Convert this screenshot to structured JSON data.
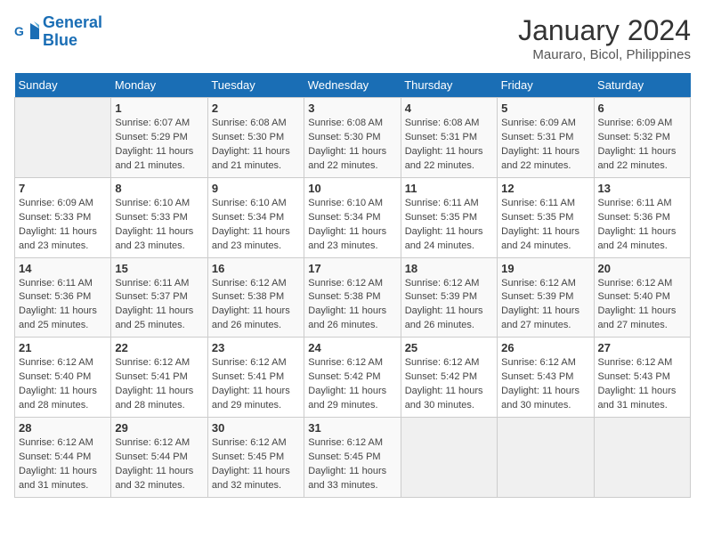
{
  "logo": {
    "line1": "General",
    "line2": "Blue"
  },
  "title": "January 2024",
  "subtitle": "Mauraro, Bicol, Philippines",
  "days_of_week": [
    "Sunday",
    "Monday",
    "Tuesday",
    "Wednesday",
    "Thursday",
    "Friday",
    "Saturday"
  ],
  "weeks": [
    [
      {
        "num": "",
        "info": ""
      },
      {
        "num": "1",
        "info": "Sunrise: 6:07 AM\nSunset: 5:29 PM\nDaylight: 11 hours and 21 minutes."
      },
      {
        "num": "2",
        "info": "Sunrise: 6:08 AM\nSunset: 5:30 PM\nDaylight: 11 hours and 21 minutes."
      },
      {
        "num": "3",
        "info": "Sunrise: 6:08 AM\nSunset: 5:30 PM\nDaylight: 11 hours and 22 minutes."
      },
      {
        "num": "4",
        "info": "Sunrise: 6:08 AM\nSunset: 5:31 PM\nDaylight: 11 hours and 22 minutes."
      },
      {
        "num": "5",
        "info": "Sunrise: 6:09 AM\nSunset: 5:31 PM\nDaylight: 11 hours and 22 minutes."
      },
      {
        "num": "6",
        "info": "Sunrise: 6:09 AM\nSunset: 5:32 PM\nDaylight: 11 hours and 22 minutes."
      }
    ],
    [
      {
        "num": "7",
        "info": "Sunrise: 6:09 AM\nSunset: 5:33 PM\nDaylight: 11 hours and 23 minutes."
      },
      {
        "num": "8",
        "info": "Sunrise: 6:10 AM\nSunset: 5:33 PM\nDaylight: 11 hours and 23 minutes."
      },
      {
        "num": "9",
        "info": "Sunrise: 6:10 AM\nSunset: 5:34 PM\nDaylight: 11 hours and 23 minutes."
      },
      {
        "num": "10",
        "info": "Sunrise: 6:10 AM\nSunset: 5:34 PM\nDaylight: 11 hours and 23 minutes."
      },
      {
        "num": "11",
        "info": "Sunrise: 6:11 AM\nSunset: 5:35 PM\nDaylight: 11 hours and 24 minutes."
      },
      {
        "num": "12",
        "info": "Sunrise: 6:11 AM\nSunset: 5:35 PM\nDaylight: 11 hours and 24 minutes."
      },
      {
        "num": "13",
        "info": "Sunrise: 6:11 AM\nSunset: 5:36 PM\nDaylight: 11 hours and 24 minutes."
      }
    ],
    [
      {
        "num": "14",
        "info": "Sunrise: 6:11 AM\nSunset: 5:36 PM\nDaylight: 11 hours and 25 minutes."
      },
      {
        "num": "15",
        "info": "Sunrise: 6:11 AM\nSunset: 5:37 PM\nDaylight: 11 hours and 25 minutes."
      },
      {
        "num": "16",
        "info": "Sunrise: 6:12 AM\nSunset: 5:38 PM\nDaylight: 11 hours and 26 minutes."
      },
      {
        "num": "17",
        "info": "Sunrise: 6:12 AM\nSunset: 5:38 PM\nDaylight: 11 hours and 26 minutes."
      },
      {
        "num": "18",
        "info": "Sunrise: 6:12 AM\nSunset: 5:39 PM\nDaylight: 11 hours and 26 minutes."
      },
      {
        "num": "19",
        "info": "Sunrise: 6:12 AM\nSunset: 5:39 PM\nDaylight: 11 hours and 27 minutes."
      },
      {
        "num": "20",
        "info": "Sunrise: 6:12 AM\nSunset: 5:40 PM\nDaylight: 11 hours and 27 minutes."
      }
    ],
    [
      {
        "num": "21",
        "info": "Sunrise: 6:12 AM\nSunset: 5:40 PM\nDaylight: 11 hours and 28 minutes."
      },
      {
        "num": "22",
        "info": "Sunrise: 6:12 AM\nSunset: 5:41 PM\nDaylight: 11 hours and 28 minutes."
      },
      {
        "num": "23",
        "info": "Sunrise: 6:12 AM\nSunset: 5:41 PM\nDaylight: 11 hours and 29 minutes."
      },
      {
        "num": "24",
        "info": "Sunrise: 6:12 AM\nSunset: 5:42 PM\nDaylight: 11 hours and 29 minutes."
      },
      {
        "num": "25",
        "info": "Sunrise: 6:12 AM\nSunset: 5:42 PM\nDaylight: 11 hours and 30 minutes."
      },
      {
        "num": "26",
        "info": "Sunrise: 6:12 AM\nSunset: 5:43 PM\nDaylight: 11 hours and 30 minutes."
      },
      {
        "num": "27",
        "info": "Sunrise: 6:12 AM\nSunset: 5:43 PM\nDaylight: 11 hours and 31 minutes."
      }
    ],
    [
      {
        "num": "28",
        "info": "Sunrise: 6:12 AM\nSunset: 5:44 PM\nDaylight: 11 hours and 31 minutes."
      },
      {
        "num": "29",
        "info": "Sunrise: 6:12 AM\nSunset: 5:44 PM\nDaylight: 11 hours and 32 minutes."
      },
      {
        "num": "30",
        "info": "Sunrise: 6:12 AM\nSunset: 5:45 PM\nDaylight: 11 hours and 32 minutes."
      },
      {
        "num": "31",
        "info": "Sunrise: 6:12 AM\nSunset: 5:45 PM\nDaylight: 11 hours and 33 minutes."
      },
      {
        "num": "",
        "info": ""
      },
      {
        "num": "",
        "info": ""
      },
      {
        "num": "",
        "info": ""
      }
    ]
  ]
}
